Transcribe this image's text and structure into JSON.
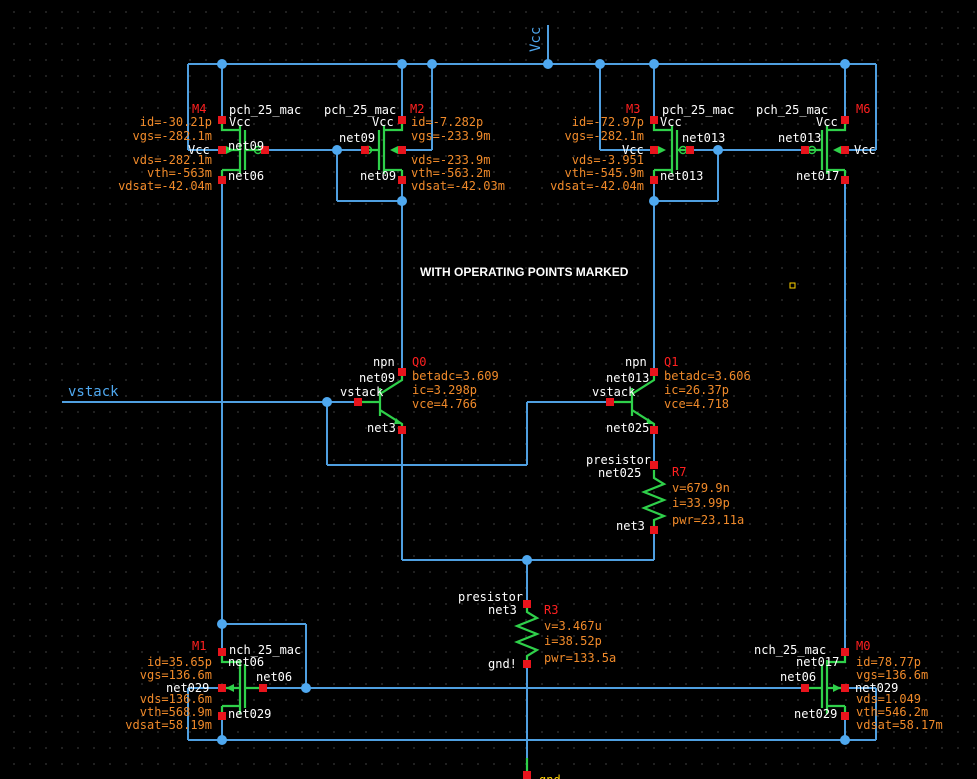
{
  "title": "WITH OPERATING POINTS MARKED",
  "nets": {
    "vcc": "Vcc",
    "vstack": "vstack",
    "gnd": "gnd"
  },
  "colors": {
    "wire": "#4f9fe0",
    "device": "#2fd04a",
    "pin": "#e8141c",
    "param": "#f08a2a",
    "background": "#000000"
  },
  "devices": {
    "M4": {
      "name": "M4",
      "model": "pch_25_mac",
      "body": "Vcc",
      "gate": "net09",
      "drain": "net06",
      "source": "Vcc",
      "params": [
        "id=-30.21p",
        "vgs=-282.1m",
        "vds=-282.1m",
        "vth=-563m",
        "vdsat=-42.04m"
      ]
    },
    "M2": {
      "name": "M2",
      "model": "pch_25_mac",
      "body": "Vcc",
      "gate": "net09",
      "drain": "net09",
      "params": [
        "id=-7.282p",
        "vgs=-233.9m",
        "vds=-233.9m",
        "vth=-563.2m",
        "vdsat=-42.03m"
      ]
    },
    "M3": {
      "name": "M3",
      "model": "pch_25_mac",
      "body": "Vcc",
      "gate": "net013",
      "drain": "net013",
      "source": "Vcc",
      "params": [
        "id=-72.97p",
        "vgs=-282.1m",
        "vds=-3.951",
        "vth=-545.9m",
        "vdsat=-42.04m"
      ]
    },
    "M6": {
      "name": "M6",
      "model": "pch_25_mac",
      "body": "Vcc",
      "gate": "net013",
      "drain": "net017",
      "source": "Vcc",
      "params": []
    },
    "Q0": {
      "name": "Q0",
      "model": "npn",
      "collector": "net09",
      "base": "vstack",
      "emitter": "net3",
      "params": [
        "betadc=3.609",
        "ic=3.298p",
        "vce=4.766"
      ]
    },
    "Q1": {
      "name": "Q1",
      "model": "npn",
      "collector": "net013",
      "base": "vstack",
      "emitter": "net025",
      "params": [
        "betadc=3.606",
        "ic=26.37p",
        "vce=4.718"
      ]
    },
    "R7": {
      "name": "R7",
      "model": "presistor",
      "plus": "net025",
      "minus": "net3",
      "params": [
        "v=679.9n",
        "i=33.99p",
        "pwr=23.11a"
      ]
    },
    "R3": {
      "name": "R3",
      "model": "presistor",
      "plus": "net3",
      "minus": "gnd!",
      "params": [
        "v=3.467u",
        "i=38.52p",
        "pwr=133.5a"
      ]
    },
    "M1": {
      "name": "M1",
      "model": "nch_25_mac",
      "drain": "net06",
      "gate": "net06",
      "source": "net029",
      "body": "net029",
      "params": [
        "id=35.65p",
        "vgs=136.6m",
        "vds=136.6m",
        "vth=568.9m",
        "vdsat=58.19m"
      ]
    },
    "M0": {
      "name": "M0",
      "model": "nch_25_mac",
      "drain": "net017",
      "gate": "net06",
      "source": "net029",
      "body": "net029",
      "params": [
        "id=78.77p",
        "vgs=136.6m",
        "vds=1.049",
        "vth=546.2m",
        "vdsat=58.17m"
      ]
    }
  }
}
